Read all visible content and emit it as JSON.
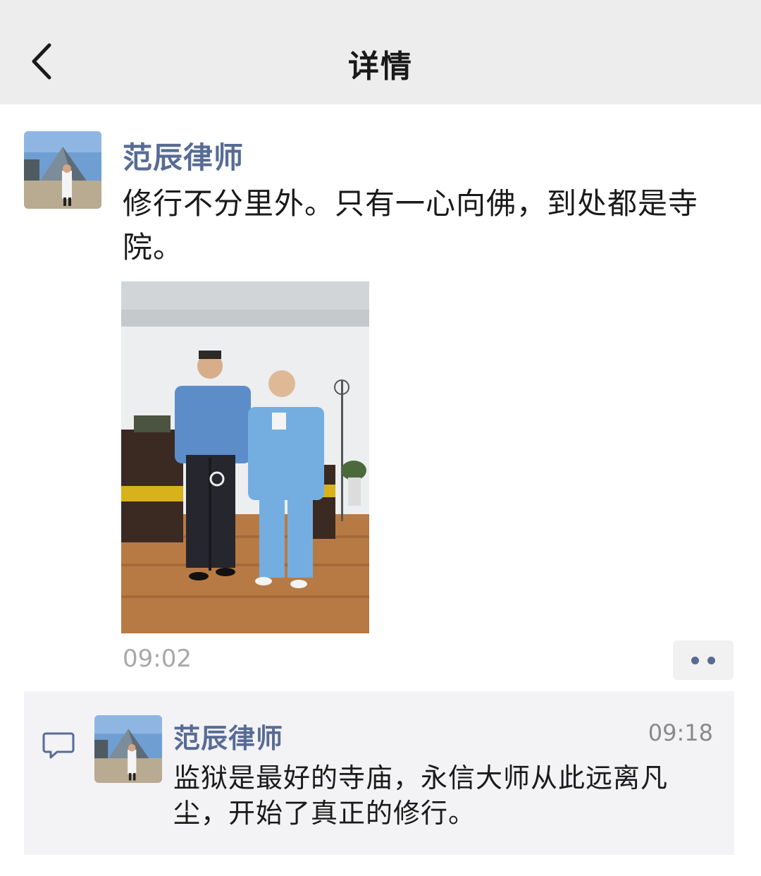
{
  "nav": {
    "title": "详情",
    "back_icon": "chevron-left-icon"
  },
  "post": {
    "author": "范辰律师",
    "text": "修行不分里外。只有一心向佛，到处都是寺院。",
    "time": "09:02",
    "photo_alt": "两人合影照片",
    "more_icon": "more-dots-icon"
  },
  "comments": [
    {
      "author": "范辰律师",
      "time": "09:18",
      "text": "监狱是最好的寺庙，永信大师从此远离凡尘，开始了真正的修行。"
    }
  ],
  "colors": {
    "link": "#576b95",
    "nav_bg": "#ededed",
    "comment_bg": "#f3f3f5"
  }
}
